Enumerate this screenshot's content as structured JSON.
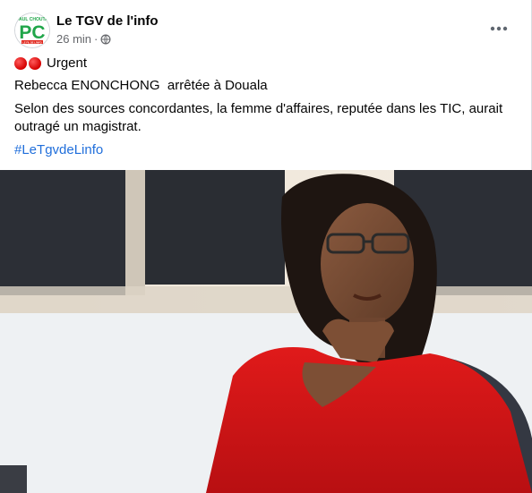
{
  "post": {
    "author": "Le TGV de l'info",
    "time": "26 min",
    "dot": "·",
    "audience_icon": "globe-icon",
    "more_icon": "more-horizontal-icon",
    "avatar": {
      "top_text": "PAUL CHOUTA",
      "letters": "PC",
      "bottom_text": "LE FIL DE L'INFO",
      "colors": {
        "green": "#21a64a",
        "red": "#e1261c"
      }
    },
    "urgent_label": "Urgent",
    "headline": "Rebecca ENONCHONG  arrêtée à Douala",
    "paragraph_line1": "Selon des sources concordantes, la femme d'affaires, reputée dans les TIC, aurait",
    "paragraph_line2": "outragé un magistrat.",
    "hashtag": "#LeTgvdeLinfo"
  },
  "colors": {
    "link": "#216fdb",
    "secondary_text": "#65676b",
    "urgent_dot": "#d40000"
  }
}
